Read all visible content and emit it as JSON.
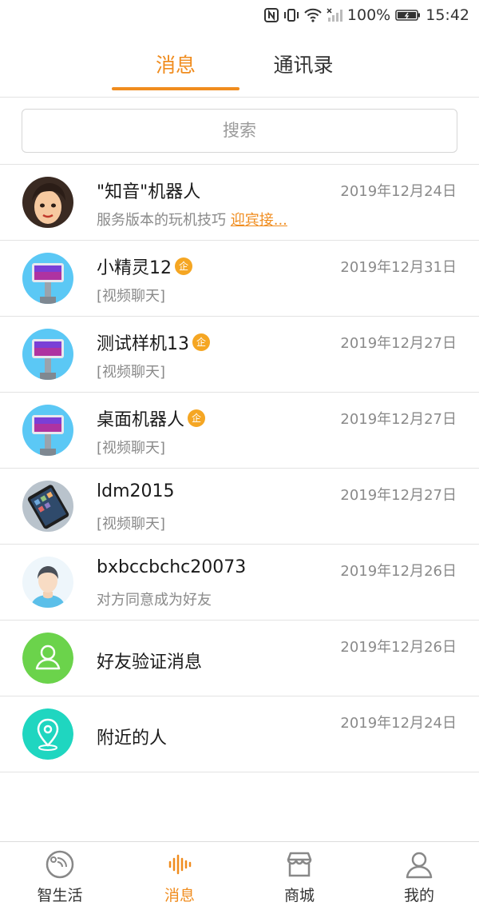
{
  "status_bar": {
    "battery": "100%",
    "time": "15:42",
    "icons": [
      "nfc-icon",
      "vibrate-icon",
      "wifi-icon",
      "signal-icon",
      "battery-icon"
    ]
  },
  "tabs": [
    {
      "label": "消息",
      "active": true
    },
    {
      "label": "通讯录",
      "active": false
    }
  ],
  "search": {
    "placeholder": "搜索"
  },
  "conversations": [
    {
      "name": "\"知音\"机器人",
      "subtitle": "服务版本的玩机技巧 ",
      "subtitle_link": "迎宾接...",
      "date": "2019年12月24日",
      "avatar": "woman-avatar",
      "badge": ""
    },
    {
      "name": "小精灵12",
      "subtitle": "[视频聊天]",
      "date": "2019年12月31日",
      "avatar": "robot-avatar",
      "badge": "企"
    },
    {
      "name": "测试样机13",
      "subtitle": "[视频聊天]",
      "date": "2019年12月27日",
      "avatar": "robot-avatar",
      "badge": "企"
    },
    {
      "name": "桌面机器人",
      "subtitle": "[视频聊天]",
      "date": "2019年12月27日",
      "avatar": "robot-avatar",
      "badge": "企"
    },
    {
      "name": "ldm2015",
      "subtitle": "[视频聊天]",
      "date": "2019年12月27日",
      "avatar": "tablet-avatar",
      "badge": ""
    },
    {
      "name": "bxbccbchc20073",
      "subtitle": "对方同意成为好友",
      "date": "2019年12月26日",
      "avatar": "man-avatar",
      "badge": ""
    },
    {
      "name": "好友验证消息",
      "subtitle": "",
      "date": "2019年12月26日",
      "avatar": "friend-verify-icon",
      "badge": ""
    },
    {
      "name": "附近的人",
      "subtitle": "",
      "date": "2019年12月24日",
      "avatar": "nearby-location-icon",
      "badge": ""
    }
  ],
  "bottom_nav": [
    {
      "label": "智生活",
      "icon": "smart-life-icon",
      "active": false
    },
    {
      "label": "消息",
      "icon": "message-wave-icon",
      "active": true
    },
    {
      "label": "商城",
      "icon": "store-icon",
      "active": false
    },
    {
      "label": "我的",
      "icon": "profile-icon",
      "active": false
    }
  ],
  "colors": {
    "accent": "#f08c1e",
    "badge": "#f5a623",
    "robot_bg": "#5bc8f5",
    "verify_green": "#6bd34b",
    "nearby_teal": "#1fd6c0"
  }
}
